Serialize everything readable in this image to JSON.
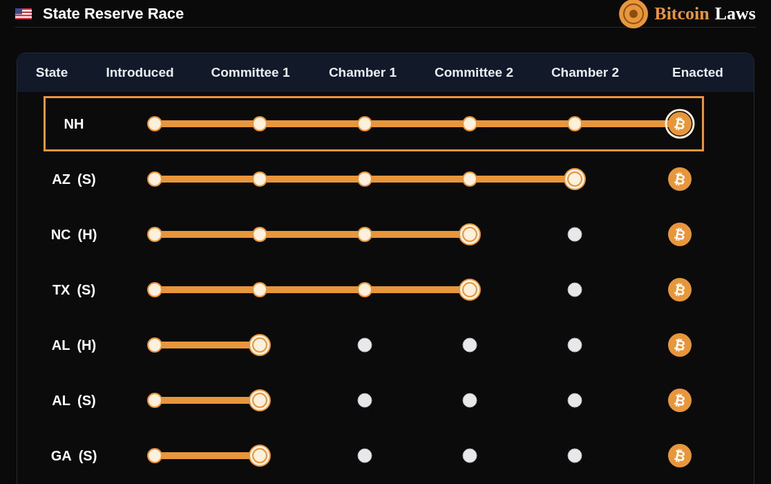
{
  "header": {
    "title": "State Reserve Race",
    "brand_first": "Bitcoin",
    "brand_second": "Laws"
  },
  "table": {
    "columns": [
      "State",
      "Introduced",
      "Committee 1",
      "Chamber 1",
      "Committee 2",
      "Chamber 2",
      "Enacted"
    ],
    "rows": [
      {
        "state": "NH",
        "level": 1,
        "selected": true,
        "goal_icon": "₿"
      },
      {
        "state": "AZ",
        "chamber": "(S)",
        "level": 0.8,
        "selected": false,
        "goal_icon": "₿"
      },
      {
        "state": "NC",
        "chamber": "(H)",
        "level": 0.6,
        "selected": false,
        "goal_icon": "₿"
      },
      {
        "state": "TX",
        "chamber": "(S)",
        "level": 0.6,
        "selected": false,
        "goal_icon": "₿"
      },
      {
        "state": "AL",
        "chamber": "(H)",
        "level": 0.2,
        "selected": false,
        "goal_icon": "₿"
      },
      {
        "state": "AL",
        "chamber": "(S)",
        "level": 0.2,
        "selected": false,
        "goal_icon": "₿"
      },
      {
        "state": "GA",
        "chamber": "(S)",
        "level": 0.2,
        "selected": false,
        "goal_icon": "₿"
      }
    ]
  }
}
